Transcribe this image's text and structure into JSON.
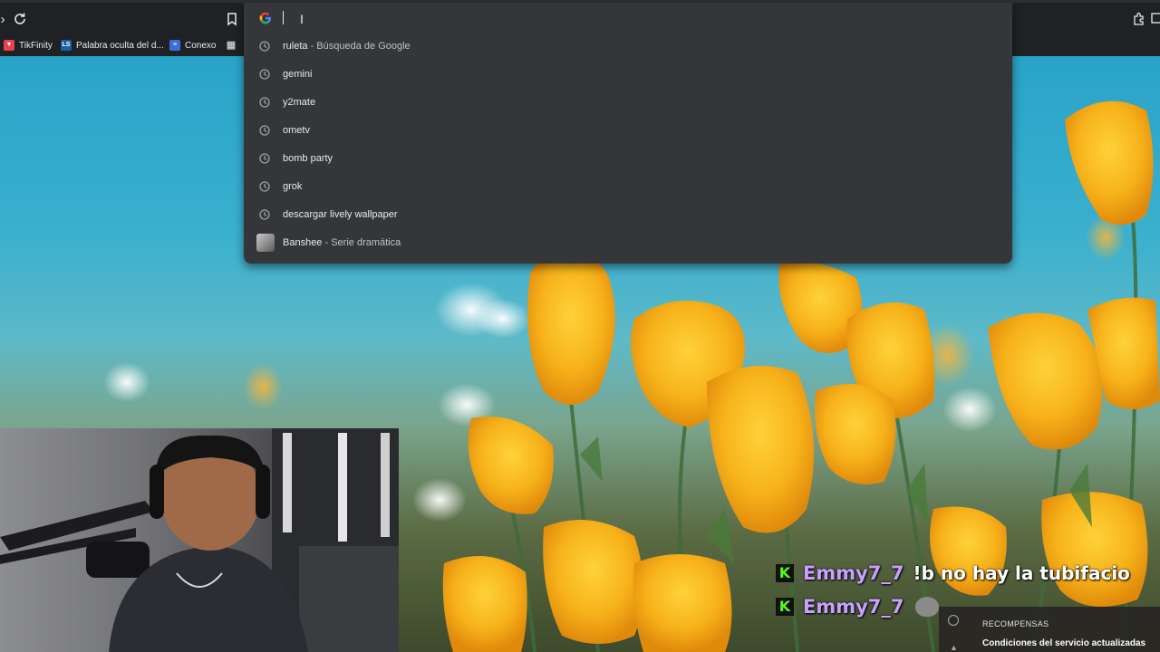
{
  "toolbar": {
    "reload_icon": "reload-icon",
    "bookmark_icon": "bookmark-star-icon",
    "extensions_icon": "extensions-icon"
  },
  "bookmarks": [
    {
      "label": "TikFinity",
      "favicon": "tikfinity-favicon",
      "color": "#e8424c"
    },
    {
      "label": "Palabra oculta del d...",
      "favicon": "ls-favicon",
      "color": "#1a5fa8"
    },
    {
      "label": "Conexo",
      "favicon": "conexo-favicon",
      "color": "#3b6fd8"
    },
    {
      "label": "",
      "favicon": "grid-favicon",
      "color": "#9aa0a6"
    }
  ],
  "omnibox": {
    "search_engine_icon": "google-g-icon",
    "value": "",
    "suggestions": [
      {
        "text": "ruleta",
        "sub": " - Búsqueda de Google",
        "icon": "history-icon"
      },
      {
        "text": "gemini",
        "sub": "",
        "icon": "history-icon"
      },
      {
        "text": "y2mate",
        "sub": "",
        "icon": "history-icon"
      },
      {
        "text": "ometv",
        "sub": "",
        "icon": "history-icon"
      },
      {
        "text": "bomb party",
        "sub": "",
        "icon": "history-icon"
      },
      {
        "text": "grok",
        "sub": "",
        "icon": "history-icon"
      },
      {
        "text": "descargar lively wallpaper",
        "sub": "",
        "icon": "history-icon"
      },
      {
        "text": "Banshee",
        "sub": " - Serie dramática",
        "icon": "entity-thumbnail"
      }
    ]
  },
  "chat": [
    {
      "badge": "K",
      "user": "Emmy7_7",
      "message": "!b no hay la tubifacio"
    },
    {
      "badge": "K",
      "user": "Emmy7_7",
      "message": ""
    }
  ],
  "notification": {
    "title": "RECOMPENSAS",
    "body": "Condiciones del servicio actualizadas"
  },
  "colors": {
    "toolbar_bg": "#202124",
    "dropdown_bg": "#35363a",
    "chat_user": "#c9a0ff",
    "kick_green": "#53fc18"
  }
}
